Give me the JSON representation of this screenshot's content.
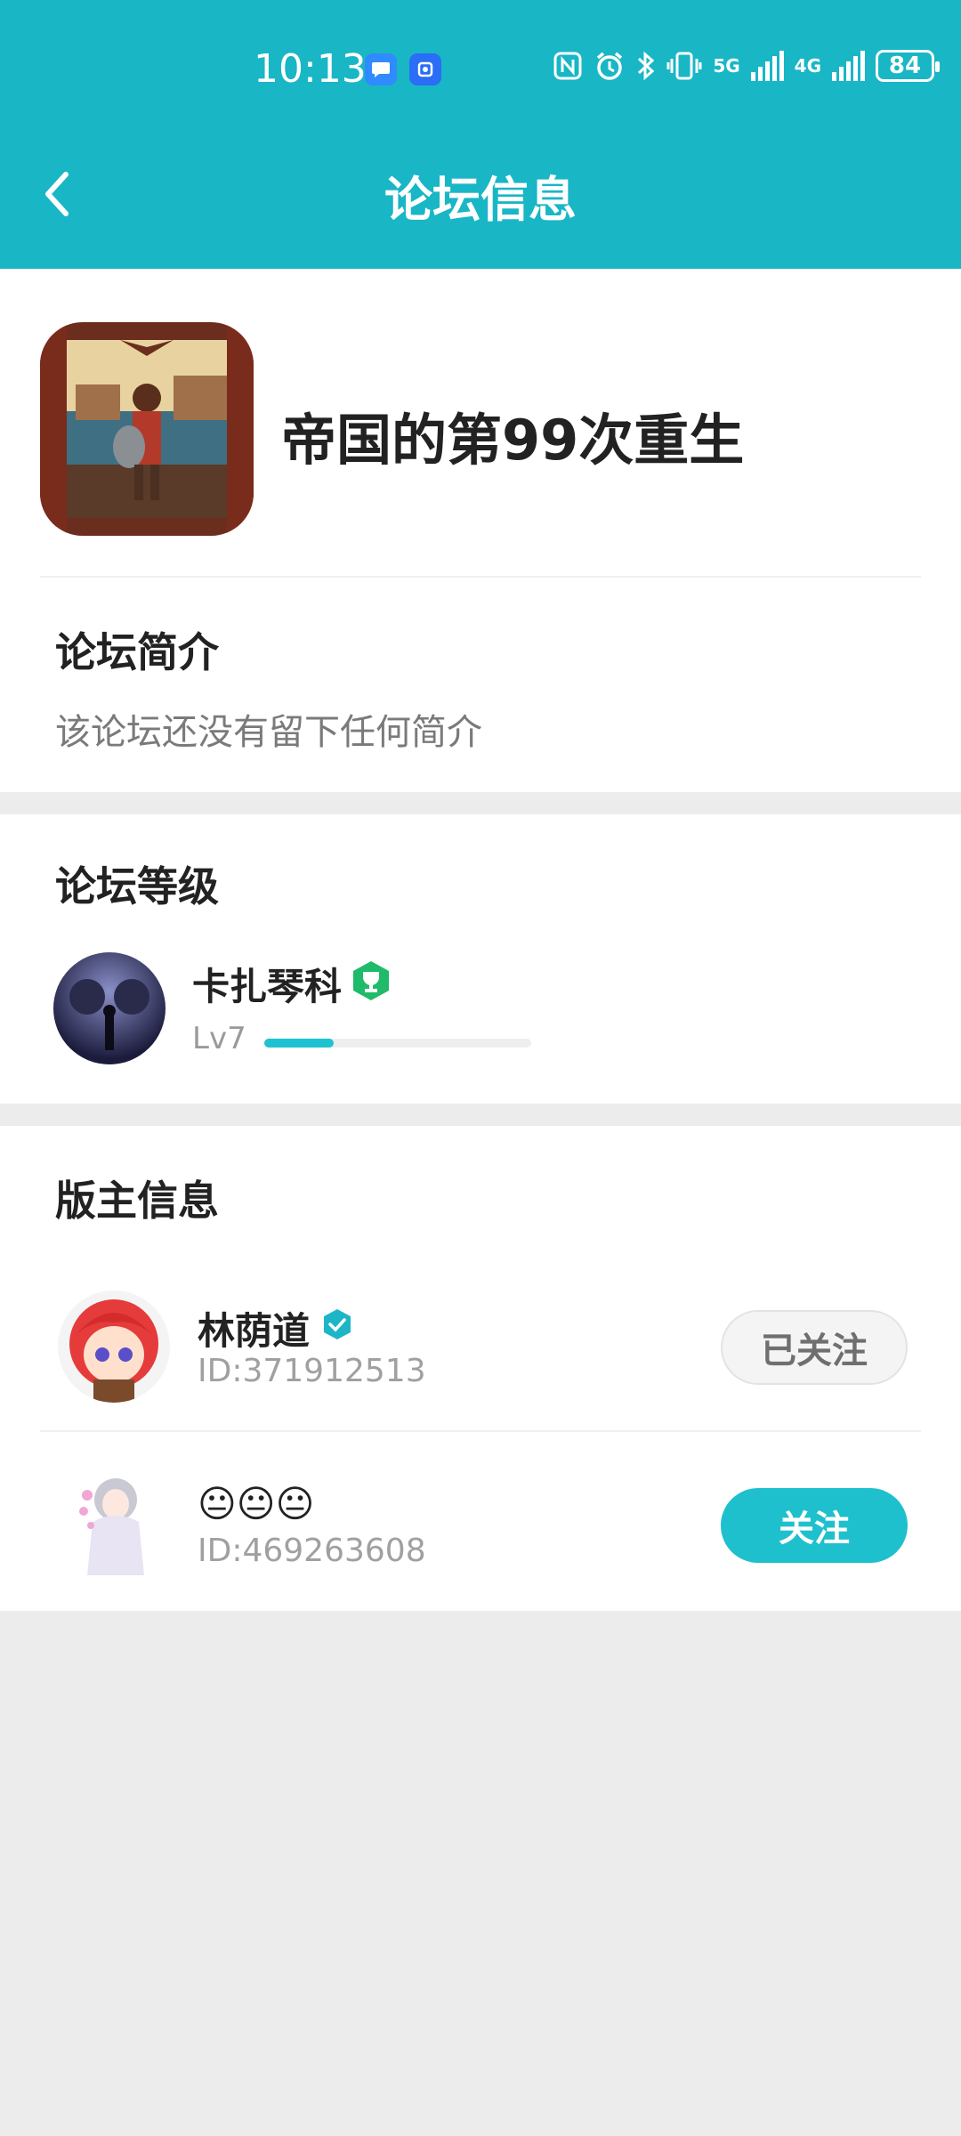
{
  "status_bar": {
    "time": "10:13",
    "net1": "5G",
    "net2": "4G",
    "battery": "84"
  },
  "header": {
    "title": "论坛信息"
  },
  "forum": {
    "name": "帝国的第99次重生",
    "intro_title": "论坛简介",
    "intro_text": "该论坛还没有留下任何简介"
  },
  "level": {
    "section_title": "论坛等级",
    "user_name": "卡扎琴科",
    "level_label": "Lv7",
    "progress": 0.26
  },
  "moderators": {
    "section_title": "版主信息",
    "items": [
      {
        "name": "林荫道",
        "id": "ID:371912513",
        "button": "已关注"
      },
      {
        "name": "😐😐😐",
        "id": "ID:469263608",
        "button": "关注"
      }
    ]
  },
  "colors": {
    "accent": "#19b6c6",
    "follow_button": "#1ec0ce",
    "badge_green": "#1fba6a"
  }
}
